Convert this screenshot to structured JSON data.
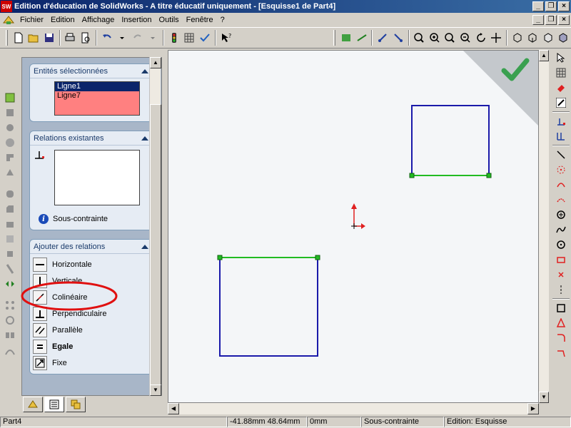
{
  "window": {
    "title": "Edition d'éducation de SolidWorks - A titre éducatif uniquement - [Esquisse1 de Part4]",
    "logo_text": "SW"
  },
  "menu": {
    "items": [
      "Fichier",
      "Edition",
      "Affichage",
      "Insertion",
      "Outils",
      "Fenêtre",
      "?"
    ]
  },
  "panel": {
    "selected_entities": {
      "title": "Entités sélectionnées",
      "items": [
        "Ligne1",
        "Ligne7"
      ]
    },
    "existing_relations": {
      "title": "Relations existantes",
      "status": "Sous-contrainte"
    },
    "add_relations": {
      "title": "Ajouter des relations",
      "items": [
        "Horizontale",
        "Verticale",
        "Colinéaire",
        "Perpendiculaire",
        "Parallèle",
        "Egale",
        "Fixe"
      ]
    }
  },
  "status": {
    "part": "Part4",
    "coords": "-41.88mm 48.64mm",
    "z": "0mm",
    "constraint": "Sous-contrainte",
    "mode": "Edition: Esquisse"
  },
  "colors": {
    "sketch_line": "#1a1aaa",
    "selected_line": "#22bb22",
    "highlight_circle": "#e01010",
    "list_bg": "#ff8080"
  }
}
